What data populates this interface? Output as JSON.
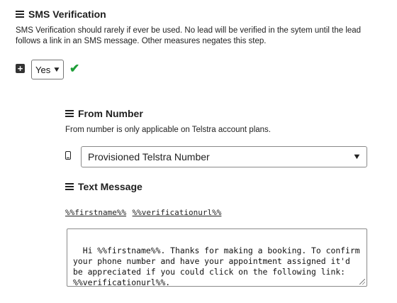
{
  "sms_section": {
    "title": "SMS Verification",
    "description": "SMS Verification should rarely if ever be used. No lead will be verified in the sytem until the lead follows a link in an SMS message. Other measures negates this step.",
    "toggle_icon": "plus-square-icon",
    "enabled_value": "Yes",
    "status_icon": "check-icon",
    "status_color": "#1e9e37"
  },
  "from_number": {
    "title": "From Number",
    "description": "From number is only applicable on Telstra account plans.",
    "icon": "phone-icon",
    "selected_value": "Provisioned Telstra Number"
  },
  "text_message": {
    "title": "Text Message",
    "tokens": [
      "%%firstname%%",
      "%%verificationurl%%"
    ],
    "body": "Hi %%firstname%%. Thanks for making a booking. To confirm your phone number and have your appointment assigned it'd be appreciated if you could click on the following link: %%verificationurl%%."
  }
}
